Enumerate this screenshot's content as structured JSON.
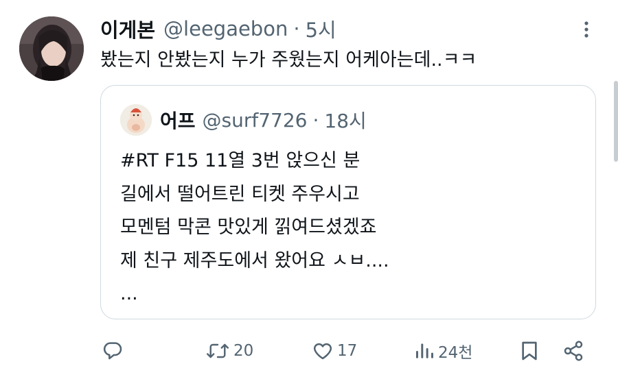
{
  "tweet": {
    "display_name": "이게본",
    "handle": "@leegaebon",
    "separator": "·",
    "time": "5시",
    "text": "봤는지 안봤는지 누가 주웠는지 어케아는데..ㅋㅋ"
  },
  "quoted_tweet": {
    "display_name": "어프",
    "handle": "@surf7726",
    "separator": "·",
    "time": "18시",
    "lines": [
      "#RT F15 11열 3번 앉으신 분",
      "길에서 떨어트린 티켓 주우시고",
      "모멘텀 막콘 맛있게 낅여드셨겠죠",
      "제 친구 제주도에서 왔어요 ㅅㅂ....",
      "..."
    ]
  },
  "actions": {
    "reply_icon": "reply-icon",
    "retweet_icon": "retweet-icon",
    "retweet_count": "20",
    "like_icon": "heart-icon",
    "like_count": "17",
    "views_icon": "views-icon",
    "views_count": "24천",
    "bookmark_icon": "bookmark-icon",
    "share_icon": "share-icon"
  },
  "colors": {
    "text": "#0f1419",
    "secondary": "#536471",
    "border": "#cfd9de"
  }
}
